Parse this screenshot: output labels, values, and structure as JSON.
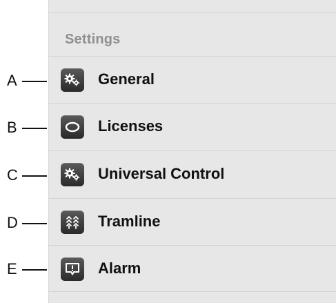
{
  "settings": {
    "section_title": "Settings",
    "items": [
      {
        "label": "General",
        "icon": "gears-icon"
      },
      {
        "label": "Licenses",
        "icon": "oval-icon"
      },
      {
        "label": "Universal Control",
        "icon": "gears-icon"
      },
      {
        "label": "Tramline",
        "icon": "tramline-arrows-icon"
      },
      {
        "label": "Alarm",
        "icon": "alarm-message-icon"
      }
    ]
  },
  "callouts": [
    "A",
    "B",
    "C",
    "D",
    "E"
  ],
  "colors": {
    "panel_background": "#e7e7e7",
    "section_title": "#8f8f8f",
    "icon_tile": "#3a3a3a",
    "label_text": "#111111"
  }
}
